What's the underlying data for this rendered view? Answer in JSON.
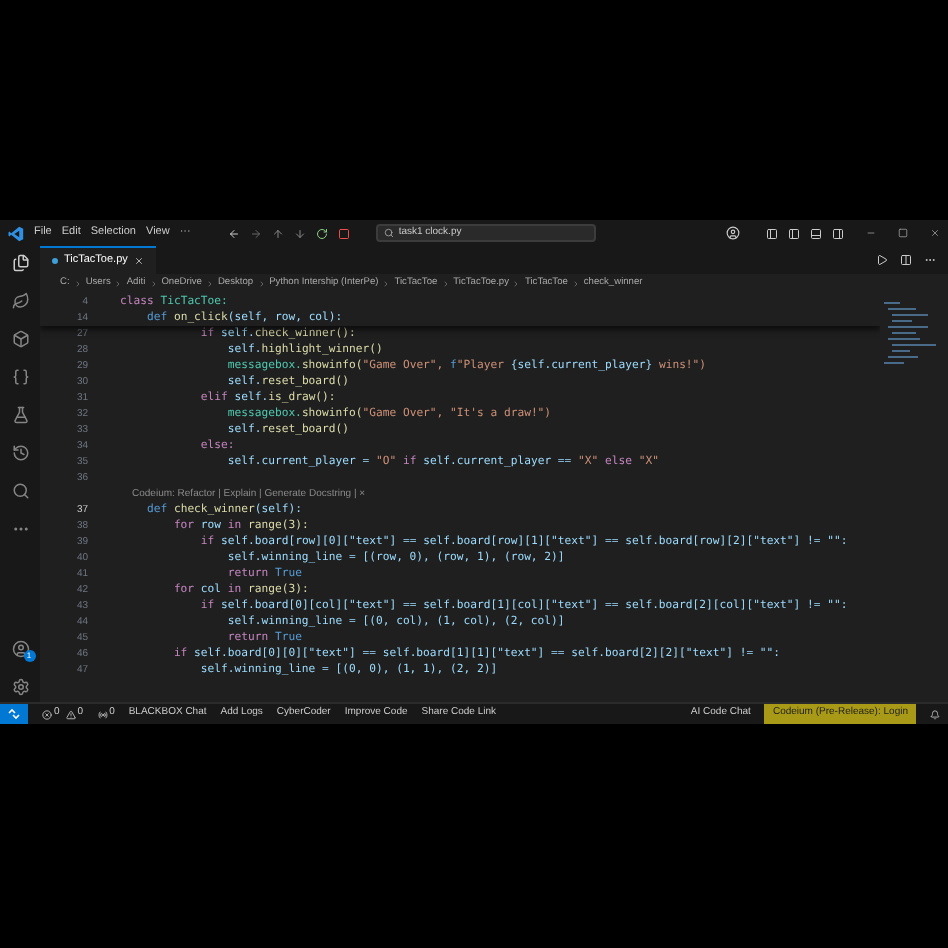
{
  "title_bar": {
    "menus": [
      "File",
      "Edit",
      "Selection",
      "View",
      "···"
    ],
    "search": "task1 clock.py"
  },
  "tabs": [
    {
      "label": "TicTacToe.py",
      "selected": true
    }
  ],
  "breadcrumb": [
    "C:",
    "Users",
    "Aditi",
    "OneDrive",
    "Desktop",
    "Python Intership (InterPe)",
    "TicTacToe",
    "TicTacToe.py",
    "TicTacToe",
    "check_winner"
  ],
  "sticky_lines": [
    {
      "number": "4",
      "tokens": [
        {
          "kind": "kw",
          "t": "class "
        },
        {
          "kind": "cls",
          "t": "TicTacToe:"
        }
      ]
    },
    {
      "number": "14",
      "tokens": [
        {
          "kind": "def",
          "t": "    def "
        },
        {
          "kind": "fn",
          "t": "on_click"
        },
        {
          "kind": "var",
          "t": "(self, row, col):"
        }
      ]
    }
  ],
  "code_lines": [
    {
      "number": "27",
      "tokens": [
        {
          "kind": "kw",
          "t": "            if "
        },
        {
          "kind": "var",
          "t": "self."
        },
        {
          "kind": "fn",
          "t": "check_winner():"
        }
      ]
    },
    {
      "number": "28",
      "tokens": [
        {
          "kind": "var",
          "t": "                self."
        },
        {
          "kind": "fn",
          "t": "highlight_winner()"
        }
      ]
    },
    {
      "number": "29",
      "tokens": [
        {
          "kind": "cls",
          "t": "                messagebox."
        },
        {
          "kind": "fn",
          "t": "showinfo("
        },
        {
          "kind": "str",
          "t": "\"Game Over\", "
        },
        {
          "kind": "def",
          "t": "f"
        },
        {
          "kind": "str",
          "t": "\"Player "
        },
        {
          "kind": "var",
          "t": "{self.current_player}"
        },
        {
          "kind": "str",
          "t": " wins!\")"
        }
      ]
    },
    {
      "number": "30",
      "tokens": [
        {
          "kind": "var",
          "t": "                self."
        },
        {
          "kind": "fn",
          "t": "reset_board()"
        }
      ]
    },
    {
      "number": "31",
      "tokens": [
        {
          "kind": "kw",
          "t": "            elif "
        },
        {
          "kind": "var",
          "t": "self."
        },
        {
          "kind": "fn",
          "t": "is_draw():"
        }
      ]
    },
    {
      "number": "32",
      "tokens": [
        {
          "kind": "cls",
          "t": "                messagebox."
        },
        {
          "kind": "fn",
          "t": "showinfo("
        },
        {
          "kind": "str",
          "t": "\"Game Over\", \"It's a draw!\")"
        }
      ]
    },
    {
      "number": "33",
      "tokens": [
        {
          "kind": "var",
          "t": "                self."
        },
        {
          "kind": "fn",
          "t": "reset_board()"
        }
      ]
    },
    {
      "number": "34",
      "tokens": [
        {
          "kind": "kw",
          "t": "            else:"
        }
      ]
    },
    {
      "number": "35",
      "tokens": [
        {
          "kind": "var",
          "t": "                self.current_player = "
        },
        {
          "kind": "str",
          "t": "\"O\""
        },
        {
          "kind": "kw",
          "t": " if "
        },
        {
          "kind": "var",
          "t": "self.current_player == "
        },
        {
          "kind": "str",
          "t": "\"X\""
        },
        {
          "kind": "kw",
          "t": " else "
        },
        {
          "kind": "str",
          "t": "\"X\""
        }
      ]
    },
    {
      "number": "36"
    },
    {
      "kind": "lens",
      "text": "Codeium: Refactor | Explain | Generate Docstring | ×"
    },
    {
      "number": "37",
      "tokens": [
        {
          "kind": "def",
          "t": "    def "
        },
        {
          "kind": "fn",
          "t": "check_winner"
        },
        {
          "kind": "var",
          "t": "(self):"
        }
      ]
    },
    {
      "number": "38",
      "tokens": [
        {
          "kind": "kw",
          "t": "        for "
        },
        {
          "kind": "var",
          "t": "row"
        },
        {
          "kind": "kw",
          "t": " in "
        },
        {
          "kind": "fn",
          "t": "range(3):"
        }
      ]
    },
    {
      "number": "39",
      "tokens": [
        {
          "kind": "kw",
          "t": "            if "
        },
        {
          "kind": "var",
          "t": "self.board[row][0][\"text\"] == self.board[row][1][\"text\"] == self.board[row][2][\"text\"] != \"\":"
        }
      ]
    },
    {
      "number": "40",
      "tokens": [
        {
          "kind": "var",
          "t": "                self.winning_line = [(row, 0), (row, 1), (row, 2)]"
        }
      ]
    },
    {
      "number": "41",
      "tokens": [
        {
          "kind": "kw",
          "t": "                return "
        },
        {
          "kind": "def",
          "t": "True"
        }
      ]
    },
    {
      "number": "42",
      "tokens": [
        {
          "kind": "kw",
          "t": "        for "
        },
        {
          "kind": "var",
          "t": "col"
        },
        {
          "kind": "kw",
          "t": " in "
        },
        {
          "kind": "fn",
          "t": "range(3):"
        }
      ]
    },
    {
      "number": "43",
      "tokens": [
        {
          "kind": "kw",
          "t": "            if "
        },
        {
          "kind": "var",
          "t": "self.board[0][col][\"text\"] == self.board[1][col][\"text\"] == self.board[2][col][\"text\"] != \"\":"
        }
      ]
    },
    {
      "number": "44",
      "tokens": [
        {
          "kind": "var",
          "t": "                self.winning_line = [(0, col), (1, col), (2, col)]"
        }
      ]
    },
    {
      "number": "45",
      "tokens": [
        {
          "kind": "kw",
          "t": "                return "
        },
        {
          "kind": "def",
          "t": "True"
        }
      ]
    },
    {
      "number": "46",
      "tokens": [
        {
          "kind": "kw",
          "t": "        if "
        },
        {
          "kind": "var",
          "t": "self.board[0][0][\"text\"] == self.board[1][1][\"text\"] == self.board[2][2][\"text\"] != \"\":"
        }
      ]
    },
    {
      "number": "47",
      "tokens": [
        {
          "kind": "var",
          "t": "            self.winning_line = [(0, 0), (1, 1), (2, 2)]"
        }
      ]
    }
  ],
  "activity_badge": "1",
  "status_bar": {
    "errors": "0",
    "warnings": "0",
    "ports": "0",
    "items": [
      "BLACKBOX Chat",
      "Add Logs",
      "CyberCoder",
      "Improve Code",
      "Share Code Link"
    ],
    "right_items": [
      "AI Code Chat"
    ],
    "login": "Codeium (Pre-Release): Login"
  }
}
